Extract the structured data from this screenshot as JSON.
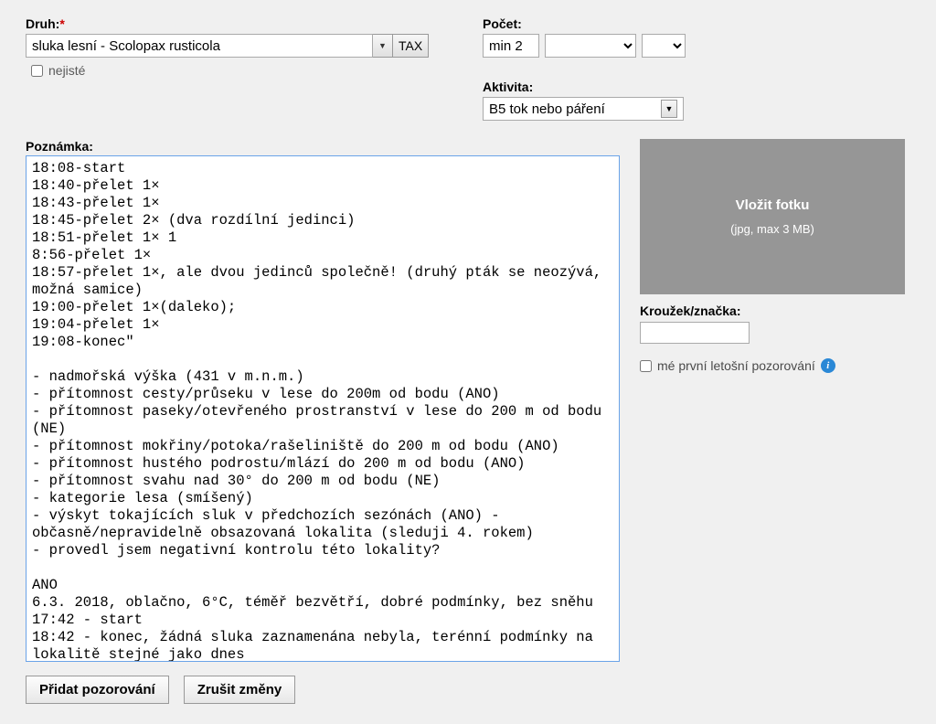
{
  "druh": {
    "label": "Druh:",
    "required": "*",
    "value": "sluka lesní - Scolopax rusticola",
    "taxBtn": "TAX",
    "nejisteLabel": "nejisté"
  },
  "pocet": {
    "label": "Počet:",
    "value": "min 2"
  },
  "aktivita": {
    "label": "Aktivita:",
    "value": "B5 tok nebo páření"
  },
  "poznamka": {
    "label": "Poznámka:",
    "text": "18:08-start\n18:40-přelet 1×\n18:43-přelet 1×\n18:45-přelet 2× (dva rozdílní jedinci)\n18:51-přelet 1× 1\n8:56-přelet 1×\n18:57-přelet 1×, ale dvou jedinců společně! (druhý pták se neozývá, možná samice)\n19:00-přelet 1×(daleko);\n19:04-přelet 1×\n19:08-konec\"\n\n- nadmořská výška (431 v m.n.m.)\n- přítomnost cesty/průseku v lese do 200m od bodu (ANO)\n- přítomnost paseky/otevřeného prostranství v lese do 200 m od bodu (NE)\n- přítomnost mokřiny/potoka/rašeliniště do 200 m od bodu (ANO)\n- přítomnost hustého podrostu/mlází do 200 m od bodu (ANO)\n- přítomnost svahu nad 30° do 200 m od bodu (NE)\n- kategorie lesa (smíšený)\n- výskyt tokajících sluk v předchozích sezónách (ANO) - občasně/nepravidelně obsazovaná lokalita (sleduji 4. rokem)\n- provedl jsem negativní kontrolu této lokality?\n\nANO\n6.3. 2018, oblačno, 6°C, téměř bezvětří, dobré podmínky, bez sněhu\n17:42 - start\n18:42 - konec, žádná sluka zaznamenána nebyla, terénní podmínky na lokalitě stejné jako dnes"
  },
  "photo": {
    "title": "Vložit fotku",
    "hint": "(jpg, max 3 MB)"
  },
  "krouzek": {
    "label": "Kroužek/značka:",
    "value": ""
  },
  "firstObs": "mé první letošní pozorování",
  "buttons": {
    "add": "Přidat pozorování",
    "cancel": "Zrušit změny"
  }
}
